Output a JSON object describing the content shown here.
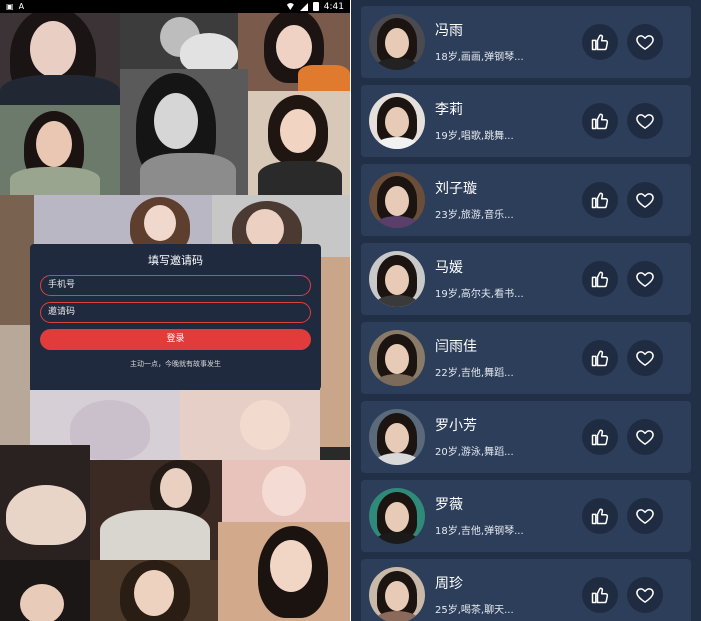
{
  "status_bar": {
    "time": "4:41"
  },
  "invite_dialog": {
    "title": "填写邀请码",
    "phone_placeholder": "手机号",
    "code_placeholder": "邀请码",
    "login_label": "登录",
    "slogan": "主动一点，今晚就有故事发生"
  },
  "users": [
    {
      "name": "冯雨",
      "desc": "18岁,画画,弹钢琴..."
    },
    {
      "name": "李莉",
      "desc": "19岁,唱歌,跳舞..."
    },
    {
      "name": "刘子璇",
      "desc": "23岁,旅游,音乐..."
    },
    {
      "name": "马媛",
      "desc": "19岁,高尔夫,看书..."
    },
    {
      "name": "闫雨佳",
      "desc": "22岁,吉他,舞蹈..."
    },
    {
      "name": "罗小芳",
      "desc": "20岁,游泳,舞蹈..."
    },
    {
      "name": "罗薇",
      "desc": "18岁,吉他,弹钢琴..."
    },
    {
      "name": "周珍",
      "desc": "25岁,喝茶,聊天..."
    }
  ],
  "icons": {
    "like": "thumbs-up-icon",
    "favorite": "heart-icon"
  },
  "colors": {
    "accent": "#e23b3b",
    "card_bg": "#2d3e5a",
    "page_bg": "#223047",
    "dialog_bg": "#1f2a3f"
  }
}
